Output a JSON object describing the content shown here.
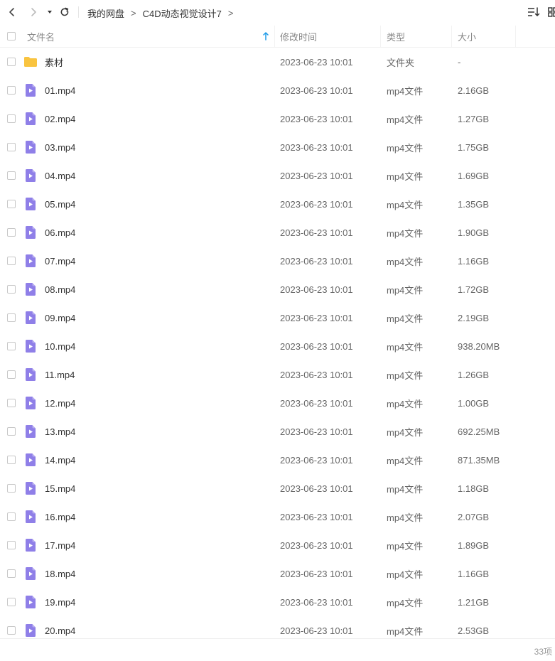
{
  "toolbar": {
    "icons": [
      "back-icon",
      "forward-icon",
      "dropdown-icon",
      "refresh-icon",
      "sort-icon",
      "grid-view-icon"
    ],
    "breadcrumb": [
      "我的网盘",
      "C4D动态视觉设计7"
    ],
    "separator": ">"
  },
  "header": {
    "name": "文件名",
    "modified": "修改时间",
    "type": "类型",
    "size": "大小",
    "sort_icon": "arrow-up-icon"
  },
  "colors": {
    "folder": "#F9C440",
    "video": "#8F7FE8",
    "sort_arrow": "#1E9BE8"
  },
  "files": [
    {
      "name": "素材",
      "modified": "2023-06-23 10:01",
      "type": "文件夹",
      "size": "-",
      "icon": "folder-icon"
    },
    {
      "name": "01.mp4",
      "modified": "2023-06-23 10:01",
      "type": "mp4文件",
      "size": "2.16GB",
      "icon": "video-file-icon"
    },
    {
      "name": "02.mp4",
      "modified": "2023-06-23 10:01",
      "type": "mp4文件",
      "size": "1.27GB",
      "icon": "video-file-icon"
    },
    {
      "name": "03.mp4",
      "modified": "2023-06-23 10:01",
      "type": "mp4文件",
      "size": "1.75GB",
      "icon": "video-file-icon"
    },
    {
      "name": "04.mp4",
      "modified": "2023-06-23 10:01",
      "type": "mp4文件",
      "size": "1.69GB",
      "icon": "video-file-icon"
    },
    {
      "name": "05.mp4",
      "modified": "2023-06-23 10:01",
      "type": "mp4文件",
      "size": "1.35GB",
      "icon": "video-file-icon"
    },
    {
      "name": "06.mp4",
      "modified": "2023-06-23 10:01",
      "type": "mp4文件",
      "size": "1.90GB",
      "icon": "video-file-icon"
    },
    {
      "name": "07.mp4",
      "modified": "2023-06-23 10:01",
      "type": "mp4文件",
      "size": "1.16GB",
      "icon": "video-file-icon"
    },
    {
      "name": "08.mp4",
      "modified": "2023-06-23 10:01",
      "type": "mp4文件",
      "size": "1.72GB",
      "icon": "video-file-icon"
    },
    {
      "name": "09.mp4",
      "modified": "2023-06-23 10:01",
      "type": "mp4文件",
      "size": "2.19GB",
      "icon": "video-file-icon"
    },
    {
      "name": "10.mp4",
      "modified": "2023-06-23 10:01",
      "type": "mp4文件",
      "size": "938.20MB",
      "icon": "video-file-icon"
    },
    {
      "name": "11.mp4",
      "modified": "2023-06-23 10:01",
      "type": "mp4文件",
      "size": "1.26GB",
      "icon": "video-file-icon"
    },
    {
      "name": "12.mp4",
      "modified": "2023-06-23 10:01",
      "type": "mp4文件",
      "size": "1.00GB",
      "icon": "video-file-icon"
    },
    {
      "name": "13.mp4",
      "modified": "2023-06-23 10:01",
      "type": "mp4文件",
      "size": "692.25MB",
      "icon": "video-file-icon"
    },
    {
      "name": "14.mp4",
      "modified": "2023-06-23 10:01",
      "type": "mp4文件",
      "size": "871.35MB",
      "icon": "video-file-icon"
    },
    {
      "name": "15.mp4",
      "modified": "2023-06-23 10:01",
      "type": "mp4文件",
      "size": "1.18GB",
      "icon": "video-file-icon"
    },
    {
      "name": "16.mp4",
      "modified": "2023-06-23 10:01",
      "type": "mp4文件",
      "size": "2.07GB",
      "icon": "video-file-icon"
    },
    {
      "name": "17.mp4",
      "modified": "2023-06-23 10:01",
      "type": "mp4文件",
      "size": "1.89GB",
      "icon": "video-file-icon"
    },
    {
      "name": "18.mp4",
      "modified": "2023-06-23 10:01",
      "type": "mp4文件",
      "size": "1.16GB",
      "icon": "video-file-icon"
    },
    {
      "name": "19.mp4",
      "modified": "2023-06-23 10:01",
      "type": "mp4文件",
      "size": "1.21GB",
      "icon": "video-file-icon"
    },
    {
      "name": "20.mp4",
      "modified": "2023-06-23 10:01",
      "type": "mp4文件",
      "size": "2.53GB",
      "icon": "video-file-icon"
    }
  ],
  "footer": {
    "count": "33项"
  }
}
